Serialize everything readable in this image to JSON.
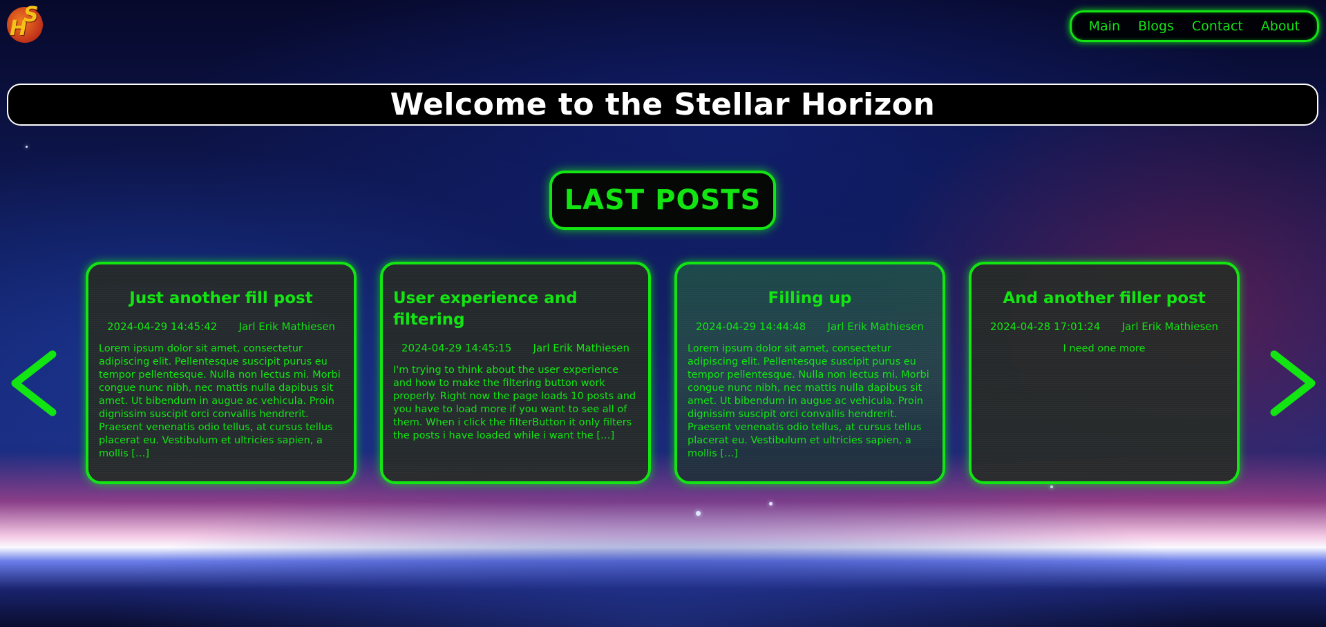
{
  "logo": {
    "letters": [
      "H",
      "S"
    ]
  },
  "nav": {
    "items": [
      {
        "label": "Main"
      },
      {
        "label": "Blogs"
      },
      {
        "label": "Contact"
      },
      {
        "label": "About"
      }
    ]
  },
  "header": {
    "title": "Welcome to the Stellar Horizon"
  },
  "posts_section": {
    "heading": "LAST POSTS",
    "posts": [
      {
        "title": "Just another fill post",
        "date": "2024-04-29 14:45:42",
        "author": "Jarl Erik Mathiesen",
        "excerpt": "Lorem ipsum dolor sit amet, consectetur adipiscing elit. Pellentesque suscipit purus eu tempor pellentesque. Nulla non lectus mi. Morbi congue nunc nibh, nec mattis nulla dapibus sit amet. Ut bibendum in augue ac vehicula. Proin dignissim suscipit orci convallis hendrerit. Praesent venenatis odio tellus, at cursus tellus placerat eu. Vestibulum et ultricies sapien, a mollis […]"
      },
      {
        "title": "User experience and filtering",
        "date": "2024-04-29 14:45:15",
        "author": "Jarl Erik Mathiesen",
        "excerpt": "I'm trying to think about the user experience and how to make the filtering button work properly. Right now the page loads 10 posts and you have to load more if you want to see all of them. When i click the filterButton it only filters the posts i have loaded while i want the […]"
      },
      {
        "title": "Filling up",
        "date": "2024-04-29 14:44:48",
        "author": "Jarl Erik Mathiesen",
        "excerpt": "Lorem ipsum dolor sit amet, consectetur adipiscing elit. Pellentesque suscipit purus eu tempor pellentesque. Nulla non lectus mi. Morbi congue nunc nibh, nec mattis nulla dapibus sit amet. Ut bibendum in augue ac vehicula. Proin dignissim suscipit orci convallis hendrerit. Praesent venenatis odio tellus, at cursus tellus placerat eu. Vestibulum et ultricies sapien, a mollis […]"
      },
      {
        "title": "And another filler post",
        "date": "2024-04-28 17:01:24",
        "author": "Jarl Erik Mathiesen",
        "excerpt": "I need one more"
      }
    ]
  },
  "carousel": {
    "prev_icon": "chevron-left-icon",
    "next_icon": "chevron-right-icon"
  },
  "colors": {
    "accent": "#13e513",
    "title_text": "#ffffff",
    "card_background": "#262a26"
  }
}
